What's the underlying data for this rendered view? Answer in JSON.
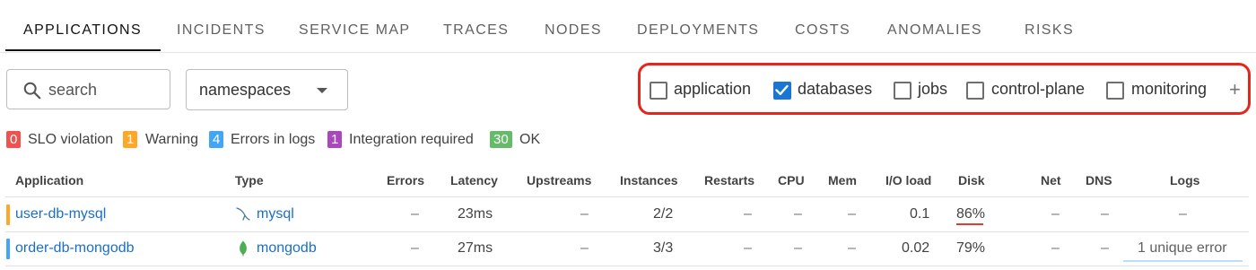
{
  "tabs": [
    "APPLICATIONS",
    "INCIDENTS",
    "SERVICE MAP",
    "TRACES",
    "NODES",
    "DEPLOYMENTS",
    "COSTS",
    "ANOMALIES",
    "RISKS"
  ],
  "filters": {
    "search_placeholder": "search",
    "namespaces_label": "namespaces",
    "app_types": [
      {
        "label": "application",
        "checked": false
      },
      {
        "label": "databases",
        "checked": true
      },
      {
        "label": "jobs",
        "checked": false
      },
      {
        "label": "control-plane",
        "checked": false
      },
      {
        "label": "monitoring",
        "checked": false
      }
    ],
    "add_label": "+"
  },
  "status": [
    {
      "count": "0",
      "label": "SLO violation",
      "color": "#ef5350"
    },
    {
      "count": "1",
      "label": "Warning",
      "color": "#ffa726"
    },
    {
      "count": "4",
      "label": "Errors in logs",
      "color": "#42a5f5"
    },
    {
      "count": "1",
      "label": "Integration required",
      "color": "#ab47bc"
    },
    {
      "count": "30",
      "label": "OK",
      "color": "#66bb6a"
    }
  ],
  "table": {
    "columns": [
      "Application",
      "Type",
      "Errors",
      "Latency",
      "Upstreams",
      "Instances",
      "Restarts",
      "CPU",
      "Mem",
      "I/O load",
      "Disk",
      "Net",
      "DNS",
      "Logs"
    ],
    "rows": [
      {
        "status_color": "#ffa726",
        "application": "user-db-mysql",
        "type": "mysql",
        "type_icon": "mysql-icon",
        "errors": "–",
        "latency": "23ms",
        "upstreams": "–",
        "instances": "2/2",
        "restarts": "–",
        "cpu": "–",
        "mem": "–",
        "io_load": "0.1",
        "disk": "86%",
        "net": "–",
        "dns": "–",
        "logs": "–"
      },
      {
        "status_color": "#42a5f5",
        "application": "order-db-mongodb",
        "type": "mongodb",
        "type_icon": "mongodb-icon",
        "errors": "–",
        "latency": "27ms",
        "upstreams": "–",
        "instances": "3/3",
        "restarts": "–",
        "cpu": "–",
        "mem": "–",
        "io_load": "0.02",
        "disk": "79%",
        "net": "–",
        "dns": "–",
        "logs": "1 unique error"
      }
    ]
  }
}
